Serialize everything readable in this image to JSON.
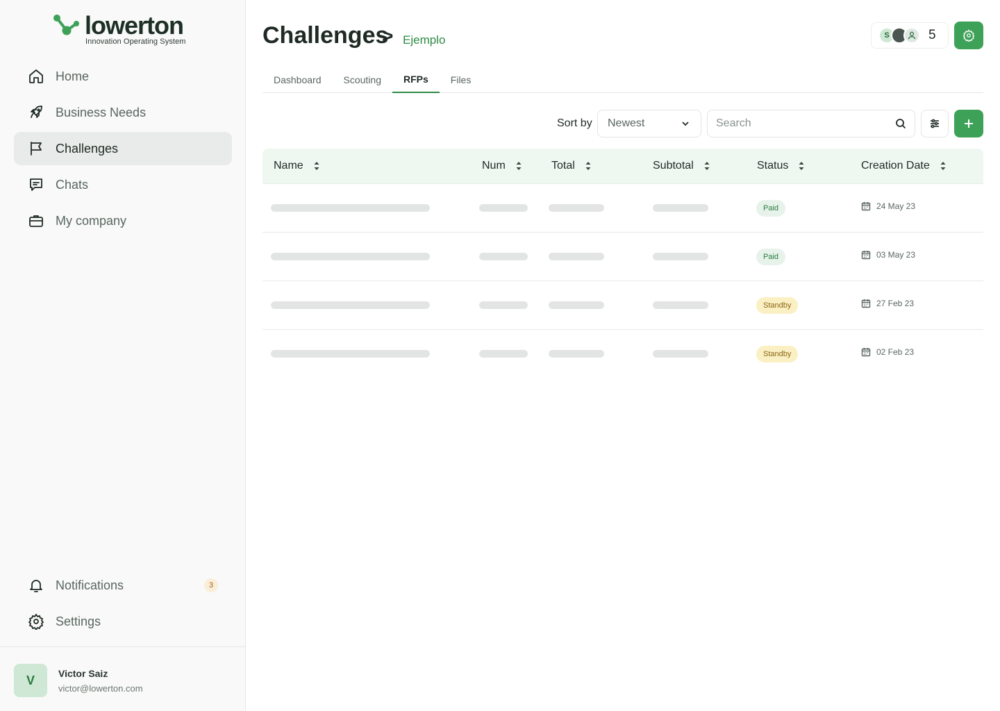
{
  "brand": {
    "name": "lowerton",
    "tagline": "Innovation Operating System"
  },
  "sidebar": {
    "items": [
      {
        "label": "Home",
        "icon": "home-icon"
      },
      {
        "label": "Business Needs",
        "icon": "rocket-icon"
      },
      {
        "label": "Challenges",
        "icon": "flag-icon",
        "active": true
      },
      {
        "label": "Chats",
        "icon": "chat-icon"
      },
      {
        "label": "My company",
        "icon": "briefcase-icon"
      }
    ],
    "bottom": {
      "notifications": {
        "label": "Notifications",
        "count": "3"
      },
      "settings": {
        "label": "Settings"
      }
    },
    "user": {
      "initial": "V",
      "name": "Victor Saiz",
      "email": "victor@lowerton.com"
    }
  },
  "header": {
    "title": "Challenges",
    "separator": ">",
    "breadcrumb": "Ejemplo",
    "members": {
      "first_initial": "S",
      "count": "5"
    }
  },
  "tabs": [
    {
      "label": "Dashboard"
    },
    {
      "label": "Scouting"
    },
    {
      "label": "RFPs",
      "active": true
    },
    {
      "label": "Files"
    }
  ],
  "toolbar": {
    "sort_label": "Sort by",
    "sort_value": "Newest",
    "search_placeholder": "Search"
  },
  "table": {
    "columns": [
      "Name",
      "Num",
      "Total",
      "Subtotal",
      "Status",
      "Creation Date"
    ],
    "rows": [
      {
        "status": "Paid",
        "date": "24 May 23"
      },
      {
        "status": "Paid",
        "date": "03 May 23"
      },
      {
        "status": "Standby",
        "date": "27 Feb 23"
      },
      {
        "status": "Standby",
        "date": "02 Feb 23"
      }
    ]
  },
  "colors": {
    "accent": "#3ea158",
    "paid_bg": "#e7f3ea",
    "standby_bg": "#fbf0c4",
    "header_bg": "#eff7f1"
  }
}
